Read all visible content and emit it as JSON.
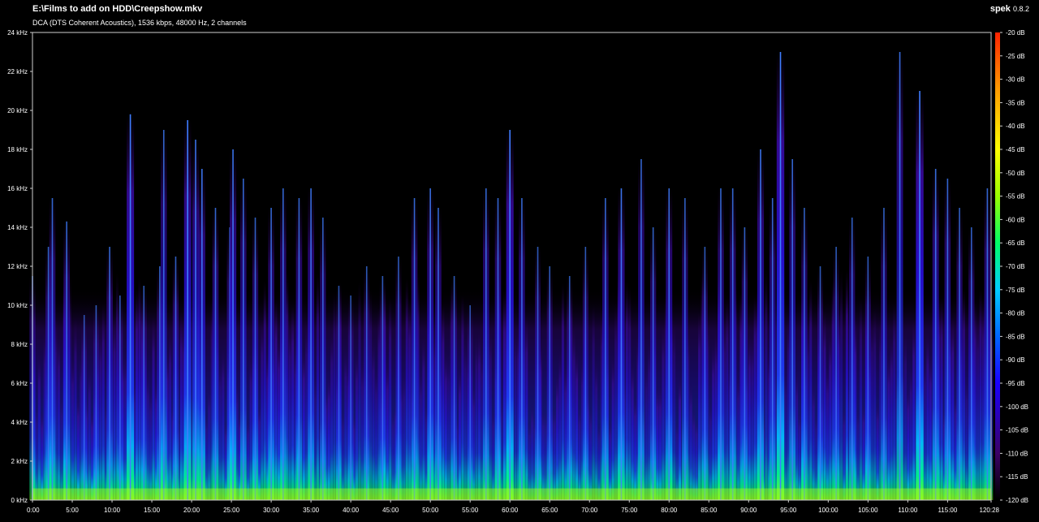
{
  "header": {
    "file_path": "E:\\Films to add on HDD\\Creepshow.mkv",
    "stream_info": "DCA (DTS Coherent Acoustics), 1536 kbps, 48000 Hz, 2 channels",
    "app_name": "spek",
    "app_version": "0.8.2"
  },
  "chart_data": {
    "type": "heatmap",
    "title": "E:\\Films to add on HDD\\Creepshow.mkv",
    "subtitle": "DCA (DTS Coherent Acoustics), 1536 kbps, 48000 Hz, 2 channels",
    "x_unit": "minutes",
    "xlim": [
      0,
      120.47
    ],
    "x_ticks": [
      "0:00",
      "5:00",
      "10:00",
      "15:00",
      "20:00",
      "25:00",
      "30:00",
      "35:00",
      "40:00",
      "45:00",
      "50:00",
      "55:00",
      "60:00",
      "65:00",
      "70:00",
      "75:00",
      "80:00",
      "85:00",
      "90:00",
      "95:00",
      "100:00",
      "105:00",
      "110:00",
      "115:00",
      "120:28"
    ],
    "y_unit": "kHz",
    "ylim": [
      0,
      24
    ],
    "y_ticks": [
      "0 kHz",
      "2 kHz",
      "4 kHz",
      "6 kHz",
      "8 kHz",
      "10 kHz",
      "12 kHz",
      "14 kHz",
      "16 kHz",
      "18 kHz",
      "20 kHz",
      "22 kHz",
      "24 kHz"
    ],
    "color_scale": {
      "unit": "dB",
      "range": [
        -120,
        -20
      ],
      "ticks": [
        "-20 dB",
        "-25 dB",
        "-30 dB",
        "-35 dB",
        "-40 dB",
        "-45 dB",
        "-50 dB",
        "-55 dB",
        "-60 dB",
        "-65 dB",
        "-70 dB",
        "-75 dB",
        "-80 dB",
        "-85 dB",
        "-90 dB",
        "-95 dB",
        "-100 dB",
        "-105 dB",
        "-110 dB",
        "-115 dB",
        "-120 dB"
      ],
      "colors": [
        "#000000",
        "#3c0066",
        "#1a00ff",
        "#0066ff",
        "#00ccff",
        "#00ff66",
        "#99ff00",
        "#ffff00",
        "#ff9900",
        "#ff2200"
      ]
    },
    "transients": [
      {
        "t": 0.0,
        "khz": 11.5,
        "level": 0.55
      },
      {
        "t": 2.0,
        "khz": 13.0,
        "level": 0.55
      },
      {
        "t": 2.5,
        "khz": 15.5,
        "level": 0.6
      },
      {
        "t": 4.3,
        "khz": 14.3,
        "level": 0.6
      },
      {
        "t": 6.5,
        "khz": 9.5,
        "level": 0.45
      },
      {
        "t": 8.0,
        "khz": 10.0,
        "level": 0.5
      },
      {
        "t": 9.7,
        "khz": 13.0,
        "level": 0.6
      },
      {
        "t": 11.0,
        "khz": 10.5,
        "level": 0.5
      },
      {
        "t": 12.3,
        "khz": 19.8,
        "level": 0.85
      },
      {
        "t": 14.0,
        "khz": 11.0,
        "level": 0.5
      },
      {
        "t": 16.0,
        "khz": 12.0,
        "level": 0.55
      },
      {
        "t": 16.5,
        "khz": 19.0,
        "level": 0.6
      },
      {
        "t": 18.0,
        "khz": 12.5,
        "level": 0.55
      },
      {
        "t": 19.5,
        "khz": 19.5,
        "level": 0.8
      },
      {
        "t": 20.5,
        "khz": 18.5,
        "level": 0.7
      },
      {
        "t": 21.3,
        "khz": 17.0,
        "level": 0.7
      },
      {
        "t": 23.0,
        "khz": 15.0,
        "level": 0.6
      },
      {
        "t": 24.8,
        "khz": 14.0,
        "level": 0.55
      },
      {
        "t": 25.2,
        "khz": 18.0,
        "level": 0.7
      },
      {
        "t": 26.5,
        "khz": 16.5,
        "level": 0.6
      },
      {
        "t": 28.0,
        "khz": 14.5,
        "level": 0.55
      },
      {
        "t": 30.0,
        "khz": 15.0,
        "level": 0.6
      },
      {
        "t": 31.5,
        "khz": 16.0,
        "level": 0.6
      },
      {
        "t": 33.5,
        "khz": 15.5,
        "level": 0.6
      },
      {
        "t": 35.0,
        "khz": 16.0,
        "level": 0.65
      },
      {
        "t": 36.5,
        "khz": 14.5,
        "level": 0.55
      },
      {
        "t": 38.5,
        "khz": 11.0,
        "level": 0.45
      },
      {
        "t": 40.0,
        "khz": 10.5,
        "level": 0.45
      },
      {
        "t": 42.0,
        "khz": 12.0,
        "level": 0.5
      },
      {
        "t": 44.0,
        "khz": 11.5,
        "level": 0.5
      },
      {
        "t": 46.0,
        "khz": 12.5,
        "level": 0.5
      },
      {
        "t": 48.0,
        "khz": 15.5,
        "level": 0.6
      },
      {
        "t": 50.0,
        "khz": 16.0,
        "level": 0.65
      },
      {
        "t": 51.0,
        "khz": 15.0,
        "level": 0.6
      },
      {
        "t": 53.0,
        "khz": 11.5,
        "level": 0.5
      },
      {
        "t": 55.0,
        "khz": 10.0,
        "level": 0.45
      },
      {
        "t": 57.0,
        "khz": 16.0,
        "level": 0.6
      },
      {
        "t": 58.5,
        "khz": 15.5,
        "level": 0.6
      },
      {
        "t": 60.0,
        "khz": 19.0,
        "level": 0.85
      },
      {
        "t": 61.5,
        "khz": 15.5,
        "level": 0.6
      },
      {
        "t": 63.5,
        "khz": 13.0,
        "level": 0.5
      },
      {
        "t": 65.0,
        "khz": 12.0,
        "level": 0.5
      },
      {
        "t": 67.5,
        "khz": 11.5,
        "level": 0.5
      },
      {
        "t": 69.5,
        "khz": 13.0,
        "level": 0.5
      },
      {
        "t": 72.0,
        "khz": 15.5,
        "level": 0.6
      },
      {
        "t": 74.0,
        "khz": 16.0,
        "level": 0.7
      },
      {
        "t": 76.5,
        "khz": 17.5,
        "level": 0.6
      },
      {
        "t": 78.0,
        "khz": 14.0,
        "level": 0.55
      },
      {
        "t": 80.0,
        "khz": 16.0,
        "level": 0.65
      },
      {
        "t": 82.0,
        "khz": 15.5,
        "level": 0.55
      },
      {
        "t": 84.5,
        "khz": 13.0,
        "level": 0.5
      },
      {
        "t": 86.5,
        "khz": 16.0,
        "level": 0.6
      },
      {
        "t": 88.0,
        "khz": 16.0,
        "level": 0.6
      },
      {
        "t": 89.5,
        "khz": 14.0,
        "level": 0.55
      },
      {
        "t": 91.5,
        "khz": 18.0,
        "level": 0.7
      },
      {
        "t": 93.0,
        "khz": 15.5,
        "level": 0.6
      },
      {
        "t": 94.0,
        "khz": 23.0,
        "level": 0.9
      },
      {
        "t": 95.5,
        "khz": 17.5,
        "level": 0.6
      },
      {
        "t": 97.0,
        "khz": 15.0,
        "level": 0.55
      },
      {
        "t": 99.0,
        "khz": 12.0,
        "level": 0.5
      },
      {
        "t": 101.0,
        "khz": 13.0,
        "level": 0.5
      },
      {
        "t": 103.0,
        "khz": 14.5,
        "level": 0.55
      },
      {
        "t": 105.0,
        "khz": 12.5,
        "level": 0.5
      },
      {
        "t": 107.0,
        "khz": 15.0,
        "level": 0.55
      },
      {
        "t": 109.0,
        "khz": 23.0,
        "level": 0.65
      },
      {
        "t": 111.5,
        "khz": 21.0,
        "level": 0.9
      },
      {
        "t": 113.5,
        "khz": 17.0,
        "level": 0.65
      },
      {
        "t": 115.0,
        "khz": 16.5,
        "level": 0.6
      },
      {
        "t": 116.5,
        "khz": 15.0,
        "level": 0.55
      },
      {
        "t": 118.0,
        "khz": 14.0,
        "level": 0.55
      },
      {
        "t": 120.0,
        "khz": 16.0,
        "level": 0.6
      }
    ]
  }
}
